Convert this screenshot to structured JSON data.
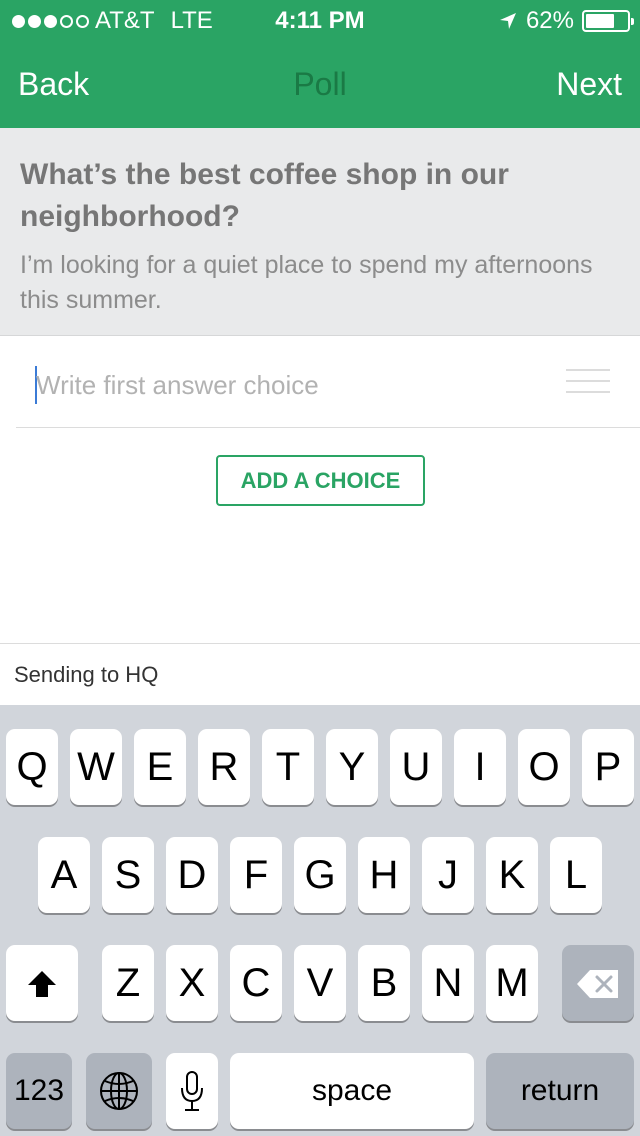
{
  "status_bar": {
    "carrier": "AT&T",
    "network": "LTE",
    "time": "4:11 PM",
    "battery": "62%"
  },
  "nav": {
    "back_label": "Back",
    "title": "Poll",
    "next_label": "Next"
  },
  "question": {
    "title": "What’s the best coffee shop in our neighborhood?",
    "description": "I’m looking for a quiet place to spend my afternoons this summer."
  },
  "answer": {
    "placeholder": "Write first answer choice"
  },
  "add_choice_label": "ADD A CHOICE",
  "sending_to": "Sending to HQ",
  "keyboard": {
    "row1": [
      "Q",
      "W",
      "E",
      "R",
      "T",
      "Y",
      "U",
      "I",
      "O",
      "P"
    ],
    "row2": [
      "A",
      "S",
      "D",
      "F",
      "G",
      "H",
      "J",
      "K",
      "L"
    ],
    "row3": [
      "Z",
      "X",
      "C",
      "V",
      "B",
      "N",
      "M"
    ],
    "numbers_label": "123",
    "space_label": "space",
    "return_label": "return"
  },
  "colors": {
    "brand_green": "#2aa464",
    "title_green": "#1a7a45"
  }
}
